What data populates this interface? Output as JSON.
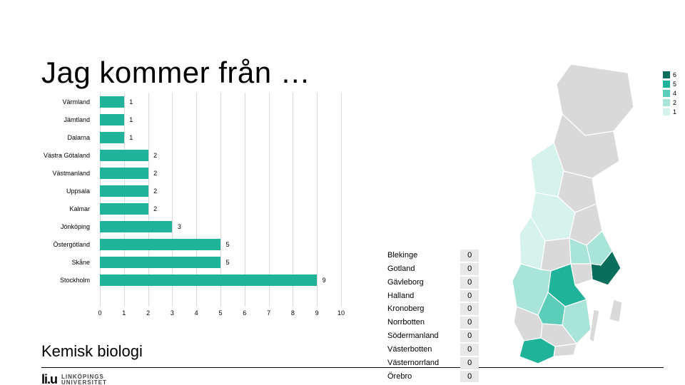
{
  "title": "Jag kommer från …",
  "subtitle": "Kemisk biologi",
  "logo": {
    "mark": "li.u",
    "uni1": "LINKÖPINGS",
    "uni2": "UNIVERSITET"
  },
  "chart_data": {
    "type": "bar",
    "orientation": "horizontal",
    "title": "Jag kommer från …",
    "xlabel": "",
    "ylabel": "",
    "xlim": [
      0,
      10
    ],
    "xticks": [
      0,
      1,
      2,
      3,
      4,
      5,
      6,
      7,
      8,
      9,
      10
    ],
    "categories": [
      "Värmland",
      "Jämtland",
      "Dalarna",
      "Västra Götaland",
      "Västmanland",
      "Uppsala",
      "Kalmar",
      "Jönköping",
      "Östergötland",
      "Skåne",
      "Stockholm"
    ],
    "values": [
      1,
      1,
      1,
      2,
      2,
      2,
      2,
      3,
      5,
      5,
      9
    ],
    "bar_color": "#1fb39a"
  },
  "zero_table": {
    "rows": [
      {
        "label": "Blekinge",
        "value": 0
      },
      {
        "label": "Gotland",
        "value": 0
      },
      {
        "label": "Gävleborg",
        "value": 0
      },
      {
        "label": "Halland",
        "value": 0
      },
      {
        "label": "Kronoberg",
        "value": 0
      },
      {
        "label": "Norrbotten",
        "value": 0
      },
      {
        "label": "Södermanland",
        "value": 0
      },
      {
        "label": "Västerbotten",
        "value": 0
      },
      {
        "label": "Västernorrland",
        "value": 0
      },
      {
        "label": "Örebro",
        "value": 0
      }
    ]
  },
  "legend": {
    "items": [
      {
        "label": "6",
        "color": "#0a6e5d"
      },
      {
        "label": "5",
        "color": "#1fb39a"
      },
      {
        "label": "4",
        "color": "#5ccdb9"
      },
      {
        "label": "2",
        "color": "#a8e4d8"
      },
      {
        "label": "1",
        "color": "#d6f2ec"
      }
    ]
  },
  "map_colors": {
    "default": "#d9d9d9",
    "regions": {
      "ostergotland": "#1fb39a",
      "skane": "#1fb39a",
      "stockholm": "#0a6e5d",
      "jonkoping": "#5ccdb9",
      "vastra_gotaland": "#a8e4d8",
      "vastmanland": "#a8e4d8",
      "uppsala": "#a8e4d8",
      "kalmar": "#a8e4d8",
      "varmland": "#d6f2ec",
      "jamtland": "#d6f2ec",
      "dalarna": "#d6f2ec"
    }
  }
}
